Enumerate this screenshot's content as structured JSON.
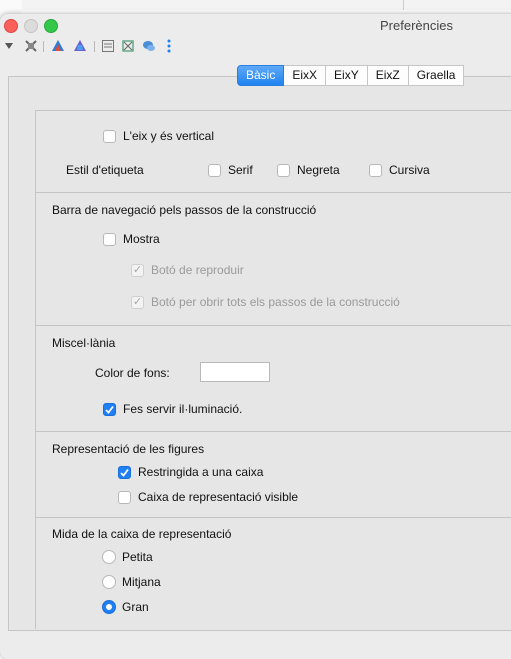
{
  "window": {
    "title": "Preferències"
  },
  "tabs": [
    "Bàsic",
    "EixX",
    "EixY",
    "EixZ",
    "Graella"
  ],
  "axes": {
    "y_vertical_label": "L'eix y és vertical",
    "label_style_label": "Estil d'etiqueta",
    "serif_label": "Serif",
    "bold_label": "Negreta",
    "italic_label": "Cursiva"
  },
  "navbar": {
    "heading": "Barra de navegació pels passos de la construcció",
    "show_label": "Mostra",
    "play_button_label": "Botó de reproduir",
    "open_steps_button_label": "Botó per obrir tots els passos de la construcció"
  },
  "misc": {
    "heading": "Miscel·lània",
    "bg_color_label": "Color de fons:",
    "use_lighting_label": "Fes servir il·luminació."
  },
  "figures": {
    "heading": "Representació de les figures",
    "clip_label": "Restringida a una caixa",
    "box_visible_label": "Caixa de representació visible"
  },
  "box_size": {
    "heading": "Mida de la caixa de representació",
    "options": [
      "Petita",
      "Mitjana",
      "Gran"
    ],
    "selected": "Gran"
  }
}
